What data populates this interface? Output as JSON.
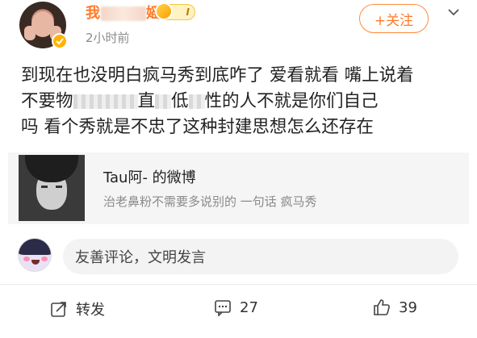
{
  "post": {
    "username_visible": "我",
    "username_suffix": "媱",
    "vip_label": "I",
    "time": "2小时前",
    "follow_label": "+关注",
    "more_icon": "chevron-down-icon",
    "text_line1": "到现在也没明白疯马秀到底咋了 爱看就看 嘴上说着",
    "text_line2_a": "不要物",
    "text_line2_b": "直",
    "text_line2_c": "低",
    "text_line2_d": "性的人不就是你们自己",
    "text_line3": "吗 看个秀就是不忠了这种封建思想怎么还存在"
  },
  "card": {
    "title": "Tau阿- 的微博",
    "desc": "治老鼻粉不需要多说别的 一句话 疯马秀"
  },
  "comment": {
    "placeholder": "友善评论，文明发言"
  },
  "actions": {
    "repost_label": "转发",
    "comment_count": "27",
    "like_count": "39"
  },
  "colors": {
    "accent": "#ff7a29",
    "muted": "#8c8c8c",
    "card_bg": "#f5f5f5"
  }
}
